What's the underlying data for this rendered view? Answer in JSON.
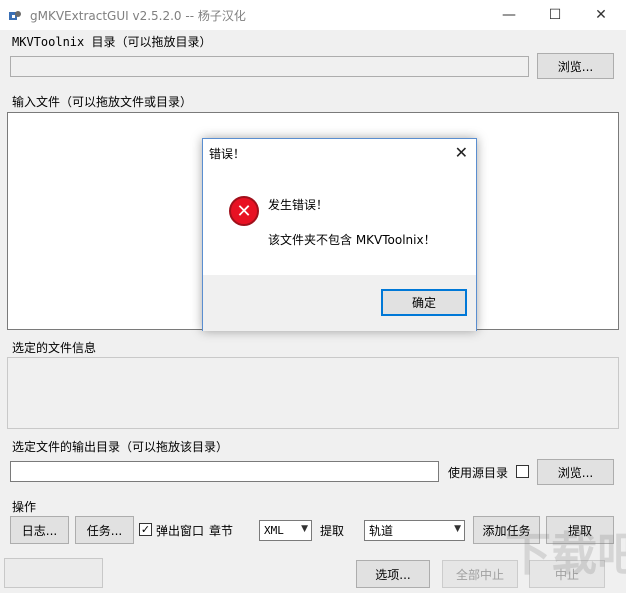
{
  "window": {
    "title": "gMKVExtractGUI v2.5.2.0 -- 杨子汉化",
    "minimize": "—",
    "maximize": "☐",
    "close": "✕"
  },
  "mkvtoolnix": {
    "label": "MKVToolnix 目录（可以拖放目录）",
    "path_value": "",
    "browse_label": "浏览..."
  },
  "input": {
    "label": "输入文件（可以拖放文件或目录）"
  },
  "file_info": {
    "label": "选定的文件信息"
  },
  "output": {
    "label": "选定文件的输出目录（可以拖放该目录）",
    "path_value": "",
    "use_source_label": "使用源目录",
    "browse_label": "浏览..."
  },
  "actions": {
    "label": "操作",
    "log_label": "日志...",
    "tasks_label": "任务...",
    "popup_label": "弹出窗口",
    "popup_checked": "✓",
    "chapters_label": "章节",
    "chapter_format": "XML",
    "extract_label": "提取",
    "extract_mode": "轨道",
    "add_task_label": "添加任务",
    "extract_button_label": "提取"
  },
  "status": {
    "options_label": "选项...",
    "abort_all_label": "全部中止",
    "abort_label": "中止"
  },
  "dialog": {
    "title": "错误！",
    "close": "✕",
    "icon": "error-icon",
    "icon_glyph": "✕",
    "heading": "发生错误！",
    "message": "该文件夹不包含 MKVToolnix！",
    "ok_label": "确定"
  },
  "watermark": "下载吧",
  "colors": {
    "dialog_border": "#5a8ed0",
    "error_red": "#e81123",
    "default_button_border": "#0078d7"
  }
}
